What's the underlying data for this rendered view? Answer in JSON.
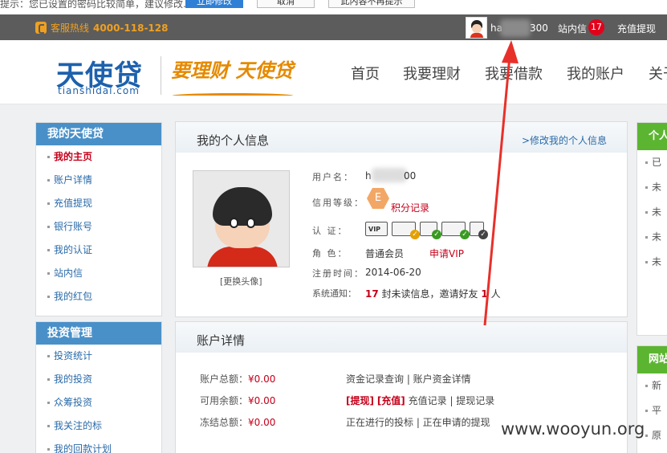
{
  "dialog": {
    "text": "提示：您已设置的密码比较简单，建议修改...",
    "confirm_label": "立即修改",
    "cancel_label": "取消",
    "no_remind_label": "此内容不再提示"
  },
  "topbar": {
    "hotline_label": "客服热线",
    "hotline_number": "4000-118-128",
    "username_prefix": "ha",
    "username_suffix": "300",
    "inbox_label": "站内信",
    "inbox_count": "17",
    "recharge_label": "充值提现"
  },
  "header": {
    "logo_main": "天使贷",
    "logo_sub": "tianshidai.com",
    "slogan": "要理财 天使贷",
    "nav": [
      "首页",
      "我要理财",
      "我要借款",
      "我的账户",
      "关于"
    ]
  },
  "sidebar": {
    "section1_title": "我的天使贷",
    "section1_items": [
      "我的主页",
      "账户详情",
      "充值提现",
      "银行账号",
      "我的认证",
      "站内信",
      "我的红包"
    ],
    "section2_title": "投资管理",
    "section2_items": [
      "投资统计",
      "我的投资",
      "众筹投资",
      "我关注的标",
      "我的回款计划"
    ]
  },
  "profile": {
    "title": "我的个人信息",
    "edit_link": ">修改我的个人信息",
    "change_avatar": "[更换头像]",
    "username_label": "用户名：",
    "username_prefix": "h",
    "username_suffix": "00",
    "credit_label": "信用等级：",
    "credit_level": "E",
    "points_link": "积分记录",
    "cert_label": "认 证：",
    "role_label": "角 色：",
    "role_value": "普通会员",
    "apply_vip": "申请VIP",
    "reg_label": "注册时间：",
    "reg_value": "2014-06-20",
    "notice_label": "系统通知：",
    "notice_count": "17",
    "notice_text1": "封未读信息，邀请好友",
    "notice_friends": "1",
    "notice_text2": "人",
    "vip_icon_text": "VIP"
  },
  "account": {
    "title": "账户详情",
    "total_label": "账户总额：",
    "total_value": "¥0.00",
    "avail_label": "可用余额：",
    "avail_value": "¥0.00",
    "frozen_label": "冻结总额：",
    "frozen_value": "¥0.00",
    "links1": "资金记录查询 | 账户资金详情",
    "withdraw": "[提现]",
    "recharge": "[充值]",
    "links2": "充值记录 | 提现记录",
    "links3": "正在进行的投标 | 正在申请的提现"
  },
  "right_panel": {
    "section1_title": "个人",
    "section1_items": [
      "已",
      "未",
      "未",
      "未",
      "未"
    ],
    "section2_title": "网站",
    "section2_items": [
      "新",
      "平",
      "原"
    ]
  },
  "watermark": "www.wooyun.org",
  "colors": {
    "brand_blue": "#1d61ad",
    "accent_orange": "#f0a020",
    "sidebar_head": "#4a90c8",
    "right_head": "#5cb531",
    "highlight_red": "#c4001a"
  }
}
